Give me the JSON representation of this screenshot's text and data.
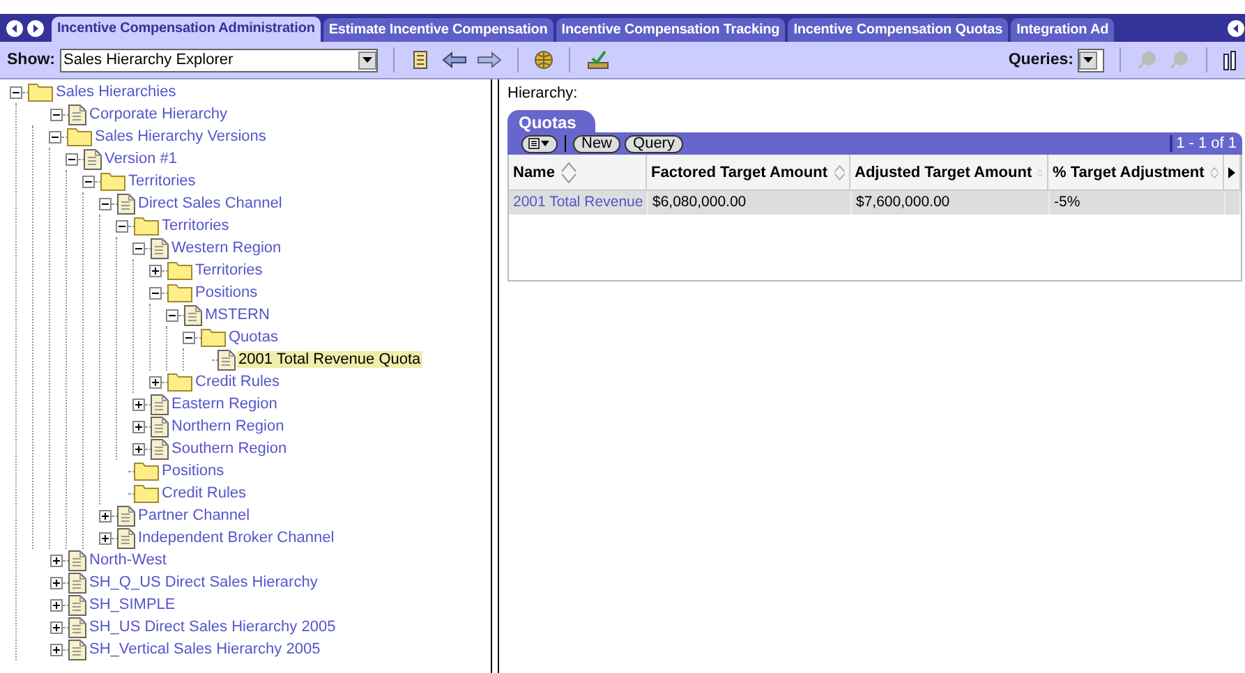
{
  "tabs": [
    {
      "label": "Incentive Compensation Administration",
      "selected": true
    },
    {
      "label": "Estimate Incentive Compensation",
      "selected": false
    },
    {
      "label": "Incentive Compensation Tracking",
      "selected": false
    },
    {
      "label": "Incentive Compensation Quotas",
      "selected": false
    },
    {
      "label": "Integration Ad",
      "selected": false
    }
  ],
  "toolbar": {
    "show_label": "Show:",
    "show_value": "Sales Hierarchy Explorer",
    "queries_label": "Queries:"
  },
  "tree": [
    {
      "label": "Sales Hierarchies",
      "kind": "folder",
      "expanded": true,
      "selected": false,
      "children": [
        {
          "label": "Corporate Hierarchy",
          "kind": "doc",
          "expanded": true,
          "selected": false,
          "children": [
            {
              "label": "Sales Hierarchy Versions",
              "kind": "folder",
              "expanded": true,
              "selected": false,
              "children": [
                {
                  "label": "Version #1",
                  "kind": "doc",
                  "expanded": true,
                  "selected": false,
                  "children": [
                    {
                      "label": "Territories",
                      "kind": "folder",
                      "expanded": true,
                      "selected": false,
                      "children": [
                        {
                          "label": "Direct Sales Channel",
                          "kind": "doc",
                          "expanded": true,
                          "selected": false,
                          "children": [
                            {
                              "label": "Territories",
                              "kind": "folder",
                              "expanded": true,
                              "selected": false,
                              "children": [
                                {
                                  "label": "Western Region",
                                  "kind": "doc",
                                  "expanded": true,
                                  "selected": false,
                                  "children": [
                                    {
                                      "label": "Territories",
                                      "kind": "folder",
                                      "expanded": false,
                                      "selected": false
                                    },
                                    {
                                      "label": "Positions",
                                      "kind": "folder",
                                      "expanded": true,
                                      "selected": false,
                                      "children": [
                                        {
                                          "label": "MSTERN",
                                          "kind": "doc",
                                          "expanded": true,
                                          "selected": false,
                                          "children": [
                                            {
                                              "label": "Quotas",
                                              "kind": "folder",
                                              "expanded": true,
                                              "selected": false,
                                              "children": [
                                                {
                                                  "label": "2001 Total Revenue Quota",
                                                  "kind": "doc",
                                                  "selected": true
                                                }
                                              ]
                                            }
                                          ]
                                        }
                                      ]
                                    },
                                    {
                                      "label": "Credit Rules",
                                      "kind": "folder",
                                      "expanded": false,
                                      "selected": false
                                    }
                                  ]
                                },
                                {
                                  "label": "Eastern Region",
                                  "kind": "doc",
                                  "expanded": false,
                                  "selected": false
                                },
                                {
                                  "label": "Northern Region",
                                  "kind": "doc",
                                  "expanded": false,
                                  "selected": false
                                },
                                {
                                  "label": "Southern Region",
                                  "kind": "doc",
                                  "expanded": false,
                                  "selected": false
                                }
                              ]
                            },
                            {
                              "label": "Positions",
                              "kind": "folder",
                              "selected": false
                            },
                            {
                              "label": "Credit Rules",
                              "kind": "folder",
                              "selected": false
                            }
                          ]
                        },
                        {
                          "label": "Partner Channel",
                          "kind": "doc",
                          "expanded": false,
                          "selected": false
                        },
                        {
                          "label": "Independent Broker Channel",
                          "kind": "doc",
                          "expanded": false,
                          "selected": false
                        }
                      ]
                    }
                  ]
                }
              ]
            }
          ]
        },
        {
          "label": "North-West",
          "kind": "doc",
          "expanded": false,
          "selected": false
        },
        {
          "label": "SH_Q_US Direct Sales Hierarchy",
          "kind": "doc",
          "expanded": false,
          "selected": false
        },
        {
          "label": "SH_SIMPLE",
          "kind": "doc",
          "expanded": false,
          "selected": false
        },
        {
          "label": "SH_US Direct Sales Hierarchy 2005",
          "kind": "doc",
          "expanded": false,
          "selected": false
        },
        {
          "label": "SH_Vertical Sales Hierarchy 2005",
          "kind": "doc",
          "expanded": false,
          "selected": false
        }
      ]
    }
  ],
  "detail": {
    "hierarchy_label": "Hierarchy:",
    "applet_title": "Quotas",
    "buttons": [
      "New",
      "Query"
    ],
    "record_count": "1 - 1 of 1",
    "columns": [
      "Name",
      "Factored Target Amount",
      "Adjusted Target Amount",
      "% Target Adjustment"
    ],
    "rows": [
      [
        "2001 Total Revenue",
        "$6,080,000.00",
        "$7,600,000.00",
        "-5%"
      ]
    ]
  }
}
